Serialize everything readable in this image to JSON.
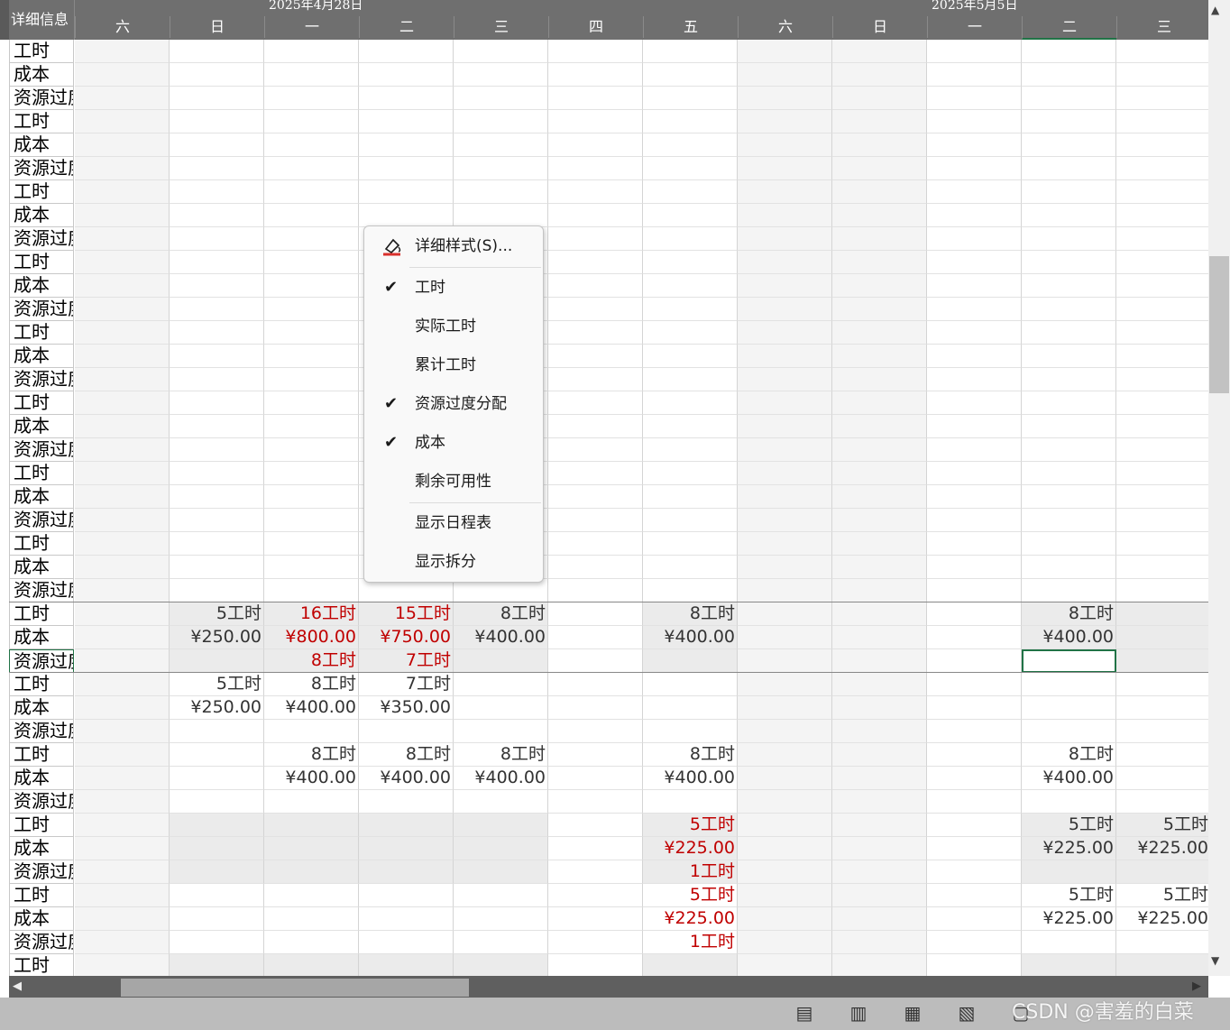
{
  "header": {
    "details_label": "详细信息",
    "weeks": [
      "2025年4月28日",
      "2025年5月5日"
    ],
    "days": [
      "六",
      "日",
      "一",
      "二",
      "三",
      "四",
      "五",
      "六",
      "日",
      "一",
      "二",
      "三"
    ]
  },
  "labels": {
    "work": "工时",
    "cost": "成本",
    "overalloc": "资源过度分配"
  },
  "rows": [
    {
      "cells": [
        "",
        "",
        "",
        "",
        "",
        "",
        "",
        "",
        "",
        "",
        "",
        ""
      ]
    },
    {
      "cells": [
        "",
        "",
        "",
        "",
        "",
        "",
        "",
        "",
        "",
        "",
        "",
        ""
      ]
    },
    {
      "cells": [
        "",
        "",
        "",
        "",
        "",
        "",
        "",
        "",
        "",
        "",
        "",
        ""
      ]
    },
    {
      "cells": [
        "",
        "",
        "",
        "",
        "",
        "",
        "",
        "",
        "",
        "",
        "",
        ""
      ]
    },
    {
      "cells": [
        "",
        "",
        "",
        "",
        "",
        "",
        "",
        "",
        "",
        "",
        "",
        ""
      ]
    },
    {
      "cells": [
        "",
        "",
        "",
        "",
        "",
        "",
        "",
        "",
        "",
        "",
        "",
        ""
      ]
    },
    {
      "cells": [
        "",
        "",
        "",
        "",
        "",
        "",
        "",
        "",
        "",
        "",
        "",
        ""
      ]
    },
    {
      "cells": [
        "",
        "",
        "",
        "",
        "",
        "",
        "",
        "",
        "",
        "",
        "",
        ""
      ]
    },
    {
      "cells": [
        "",
        "",
        "",
        "",
        "",
        "",
        "",
        "",
        "",
        "",
        "",
        ""
      ]
    },
    {
      "cells": [
        "",
        "",
        "",
        "",
        "",
        "",
        "",
        "",
        "",
        "",
        "",
        ""
      ]
    },
    {
      "cells": [
        "",
        "",
        "",
        "",
        "",
        "",
        "",
        "",
        "",
        "",
        "",
        ""
      ]
    },
    {
      "cells": [
        "",
        "",
        "",
        "",
        "",
        "",
        "",
        "",
        "",
        "",
        "",
        ""
      ]
    },
    {
      "cells": [
        "",
        "",
        "",
        "",
        "",
        "",
        "",
        "",
        "",
        "",
        "",
        ""
      ]
    },
    {
      "cells": [
        "",
        "",
        "",
        "",
        "",
        "",
        "",
        "",
        "",
        "",
        "",
        ""
      ]
    },
    {
      "cells": [
        "",
        "",
        "",
        "",
        "",
        "",
        "",
        "",
        "",
        "",
        "",
        ""
      ]
    },
    {
      "cells": [
        "",
        "",
        "",
        "",
        "",
        "",
        "",
        "",
        "",
        "",
        "",
        ""
      ]
    },
    {
      "cells": [
        "",
        "",
        "",
        "",
        "",
        "",
        "",
        "",
        "",
        "",
        "",
        ""
      ]
    },
    {
      "cells": [
        "",
        "",
        "",
        "",
        "",
        "",
        "",
        "",
        "",
        "",
        "",
        ""
      ]
    },
    {
      "cells": [
        "",
        "",
        "",
        "",
        "",
        "",
        "",
        "",
        "",
        "",
        "",
        ""
      ]
    },
    {
      "cells": [
        "",
        "",
        "",
        "",
        "",
        "",
        "",
        "",
        "",
        "",
        "",
        ""
      ]
    },
    {
      "cells": [
        "",
        "",
        "",
        "",
        "",
        "",
        "",
        "",
        "",
        "",
        "",
        ""
      ]
    },
    {
      "cells": [
        "",
        "",
        "",
        "",
        "",
        "",
        "",
        "",
        "",
        "",
        "",
        ""
      ]
    },
    {
      "cells": [
        "",
        "",
        "",
        "",
        "",
        "",
        "",
        "",
        "",
        "",
        "",
        ""
      ]
    },
    {
      "cells": [
        "",
        "",
        "",
        "",
        "",
        "",
        "",
        "",
        "",
        "",
        "",
        ""
      ]
    },
    {
      "cells": [
        "",
        "5工时",
        "16工时",
        "15工时",
        "8工时",
        "",
        "8工时",
        "",
        "",
        "",
        "8工时",
        ""
      ],
      "red": [
        2,
        3
      ]
    },
    {
      "cells": [
        "",
        "¥250.00",
        "¥800.00",
        "¥750.00",
        "¥400.00",
        "",
        "¥400.00",
        "",
        "",
        "",
        "¥400.00",
        ""
      ],
      "red": [
        2,
        3
      ]
    },
    {
      "cells": [
        "",
        "",
        "8工时",
        "7工时",
        "",
        "",
        "",
        "",
        "",
        "",
        "",
        ""
      ],
      "red": [
        2,
        3
      ]
    },
    {
      "cells": [
        "",
        "5工时",
        "8工时",
        "7工时",
        "",
        "",
        "",
        "",
        "",
        "",
        "",
        ""
      ]
    },
    {
      "cells": [
        "",
        "¥250.00",
        "¥400.00",
        "¥350.00",
        "",
        "",
        "",
        "",
        "",
        "",
        "",
        ""
      ]
    },
    {
      "cells": [
        "",
        "",
        "",
        "",
        "",
        "",
        "",
        "",
        "",
        "",
        "",
        ""
      ]
    },
    {
      "cells": [
        "",
        "",
        "8工时",
        "8工时",
        "8工时",
        "",
        "8工时",
        "",
        "",
        "",
        "8工时",
        ""
      ]
    },
    {
      "cells": [
        "",
        "",
        "¥400.00",
        "¥400.00",
        "¥400.00",
        "",
        "¥400.00",
        "",
        "",
        "",
        "¥400.00",
        ""
      ]
    },
    {
      "cells": [
        "",
        "",
        "",
        "",
        "",
        "",
        "",
        "",
        "",
        "",
        "",
        ""
      ]
    },
    {
      "cells": [
        "",
        "",
        "",
        "",
        "",
        "",
        "5工时",
        "",
        "",
        "",
        "5工时",
        "5工时"
      ],
      "red": [
        6
      ]
    },
    {
      "cells": [
        "",
        "",
        "",
        "",
        "",
        "",
        "¥225.00",
        "",
        "",
        "",
        "¥225.00",
        "¥225.00"
      ],
      "red": [
        6
      ]
    },
    {
      "cells": [
        "",
        "",
        "",
        "",
        "",
        "",
        "1工时",
        "",
        "",
        "",
        "",
        ""
      ],
      "red": [
        6
      ]
    },
    {
      "cells": [
        "",
        "",
        "",
        "",
        "",
        "",
        "5工时",
        "",
        "",
        "",
        "5工时",
        "5工时"
      ],
      "red": [
        6
      ]
    },
    {
      "cells": [
        "",
        "",
        "",
        "",
        "",
        "",
        "¥225.00",
        "",
        "",
        "",
        "¥225.00",
        "¥225.00"
      ],
      "red": [
        6
      ]
    },
    {
      "cells": [
        "",
        "",
        "",
        "",
        "",
        "",
        "1工时",
        "",
        "",
        "",
        "",
        ""
      ],
      "red": [
        6
      ]
    },
    {
      "cells": [
        "",
        "",
        "",
        "",
        "",
        "",
        "",
        "",
        "",
        "",
        "",
        ""
      ]
    }
  ],
  "context_menu": {
    "items": [
      {
        "label": "详细样式(S)...",
        "checked": false,
        "icon": "paint-icon"
      },
      {
        "label": "工时",
        "checked": true
      },
      {
        "label": "实际工时",
        "checked": false
      },
      {
        "label": "累计工时",
        "checked": false
      },
      {
        "label": "资源过度分配",
        "checked": true
      },
      {
        "label": "成本",
        "checked": true
      },
      {
        "label": "剩余可用性",
        "checked": false
      },
      {
        "label": "显示日程表",
        "checked": false
      },
      {
        "label": "显示拆分",
        "checked": false
      }
    ]
  },
  "watermark": "CSDN @害羞的白菜",
  "status_icons": [
    "gantt-view-icon",
    "task-usage-icon",
    "team-planner-icon",
    "resource-sheet-icon",
    "report-icon"
  ]
}
